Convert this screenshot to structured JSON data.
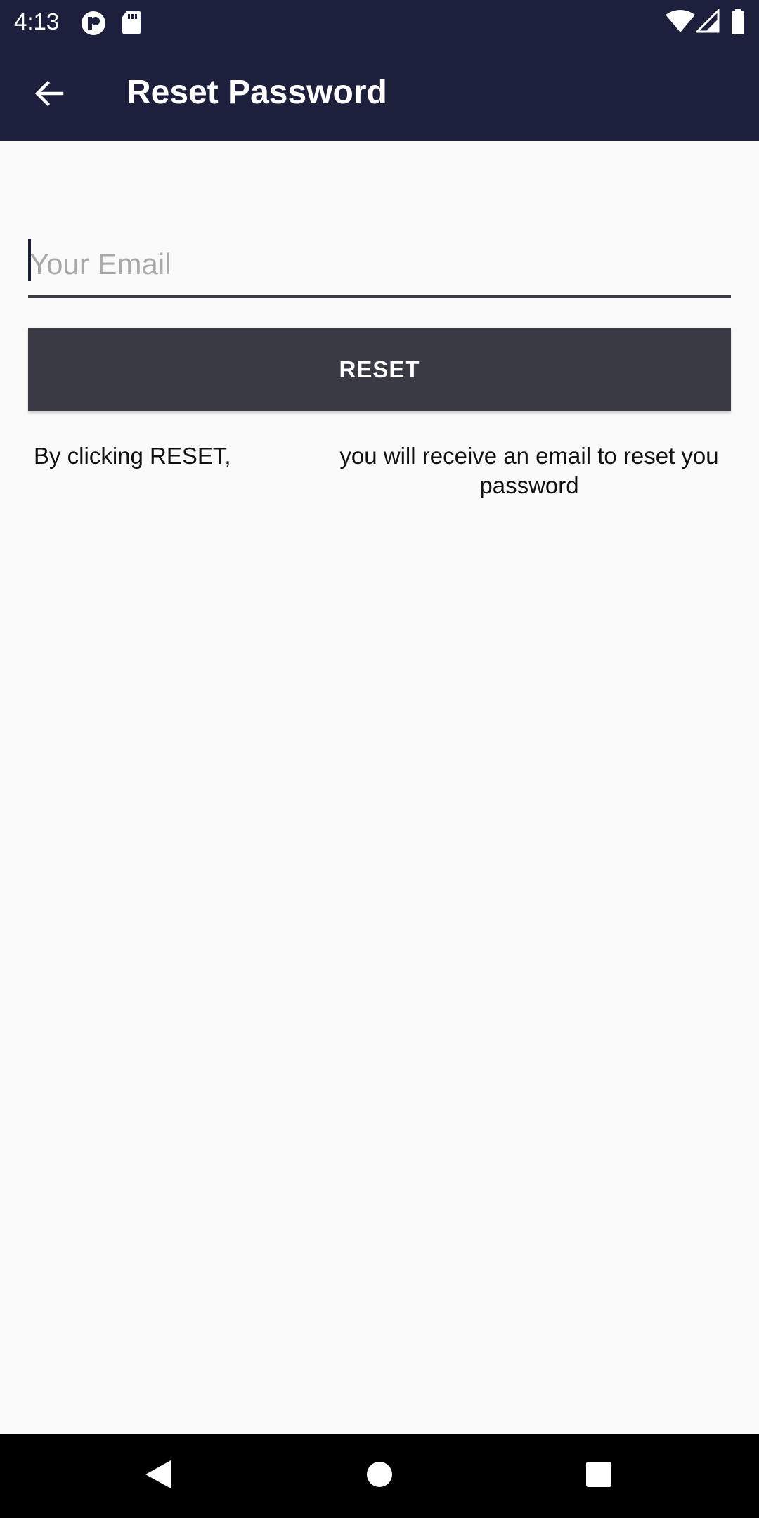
{
  "status_bar": {
    "time": "4:13",
    "left_icons": [
      "notification-app-icon",
      "sd-card-icon"
    ],
    "right_icons": [
      "wifi-icon",
      "cell-signal-icon",
      "battery-icon"
    ]
  },
  "app_bar": {
    "back_icon": "arrow-back-icon",
    "title": "Reset Password",
    "background_color": "#1d203d"
  },
  "form": {
    "email_placeholder": "Your Email",
    "email_value": "",
    "reset_label": "RESET",
    "button_color": "#3a3a44"
  },
  "info": {
    "left_text": "By clicking RESET,",
    "right_text": "you will receive an email to reset you password"
  },
  "nav_bar": {
    "buttons": [
      "back-triangle-icon",
      "home-circle-icon",
      "recents-square-icon"
    ]
  }
}
